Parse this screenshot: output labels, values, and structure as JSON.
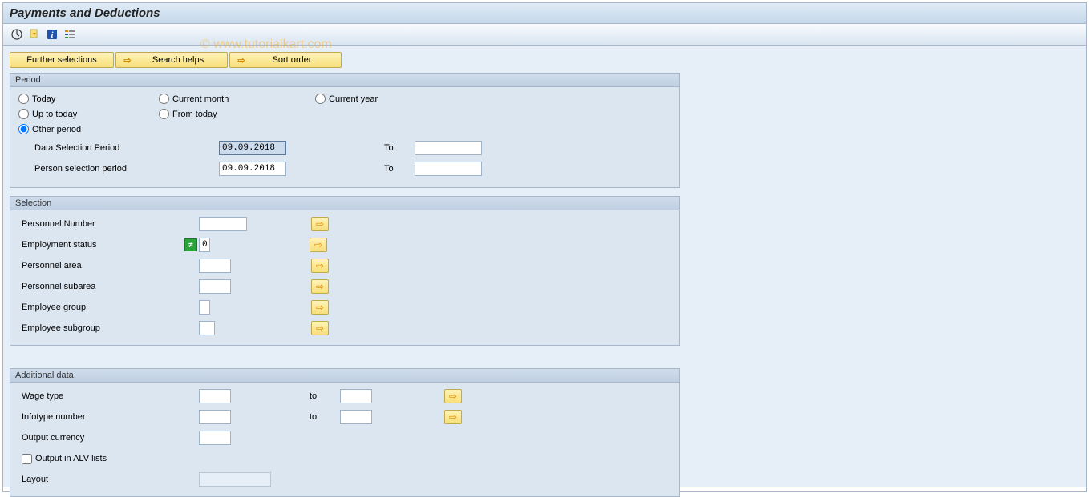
{
  "title": "Payments and Deductions",
  "watermark": "© www.tutorialkart.com",
  "buttons": {
    "further_selections": "Further selections",
    "search_helps": "Search helps",
    "sort_order": "Sort order"
  },
  "period": {
    "legend": "Period",
    "today": "Today",
    "current_month": "Current month",
    "current_year": "Current year",
    "up_to_today": "Up to today",
    "from_today": "From today",
    "other_period": "Other period",
    "data_selection_period": "Data Selection Period",
    "person_selection_period": "Person selection period",
    "to": "To",
    "date1": "09.09.2018",
    "date2": "09.09.2018",
    "date1_to": "",
    "date2_to": ""
  },
  "selection": {
    "legend": "Selection",
    "personnel_number": "Personnel Number",
    "employment_status": "Employment status",
    "employment_status_value": "0",
    "personnel_area": "Personnel area",
    "personnel_subarea": "Personnel subarea",
    "employee_group": "Employee group",
    "employee_subgroup": "Employee subgroup"
  },
  "additional": {
    "legend": "Additional data",
    "wage_type": "Wage type",
    "infotype_number": "Infotype number",
    "to": "to",
    "output_currency": "Output currency",
    "output_alv": "Output in ALV lists",
    "layout": "Layout"
  },
  "icons": {
    "execute": "⊕",
    "variant": "⎘",
    "info": "ℹ",
    "list": "≣",
    "arrow": "⇨",
    "ne": "≠"
  }
}
